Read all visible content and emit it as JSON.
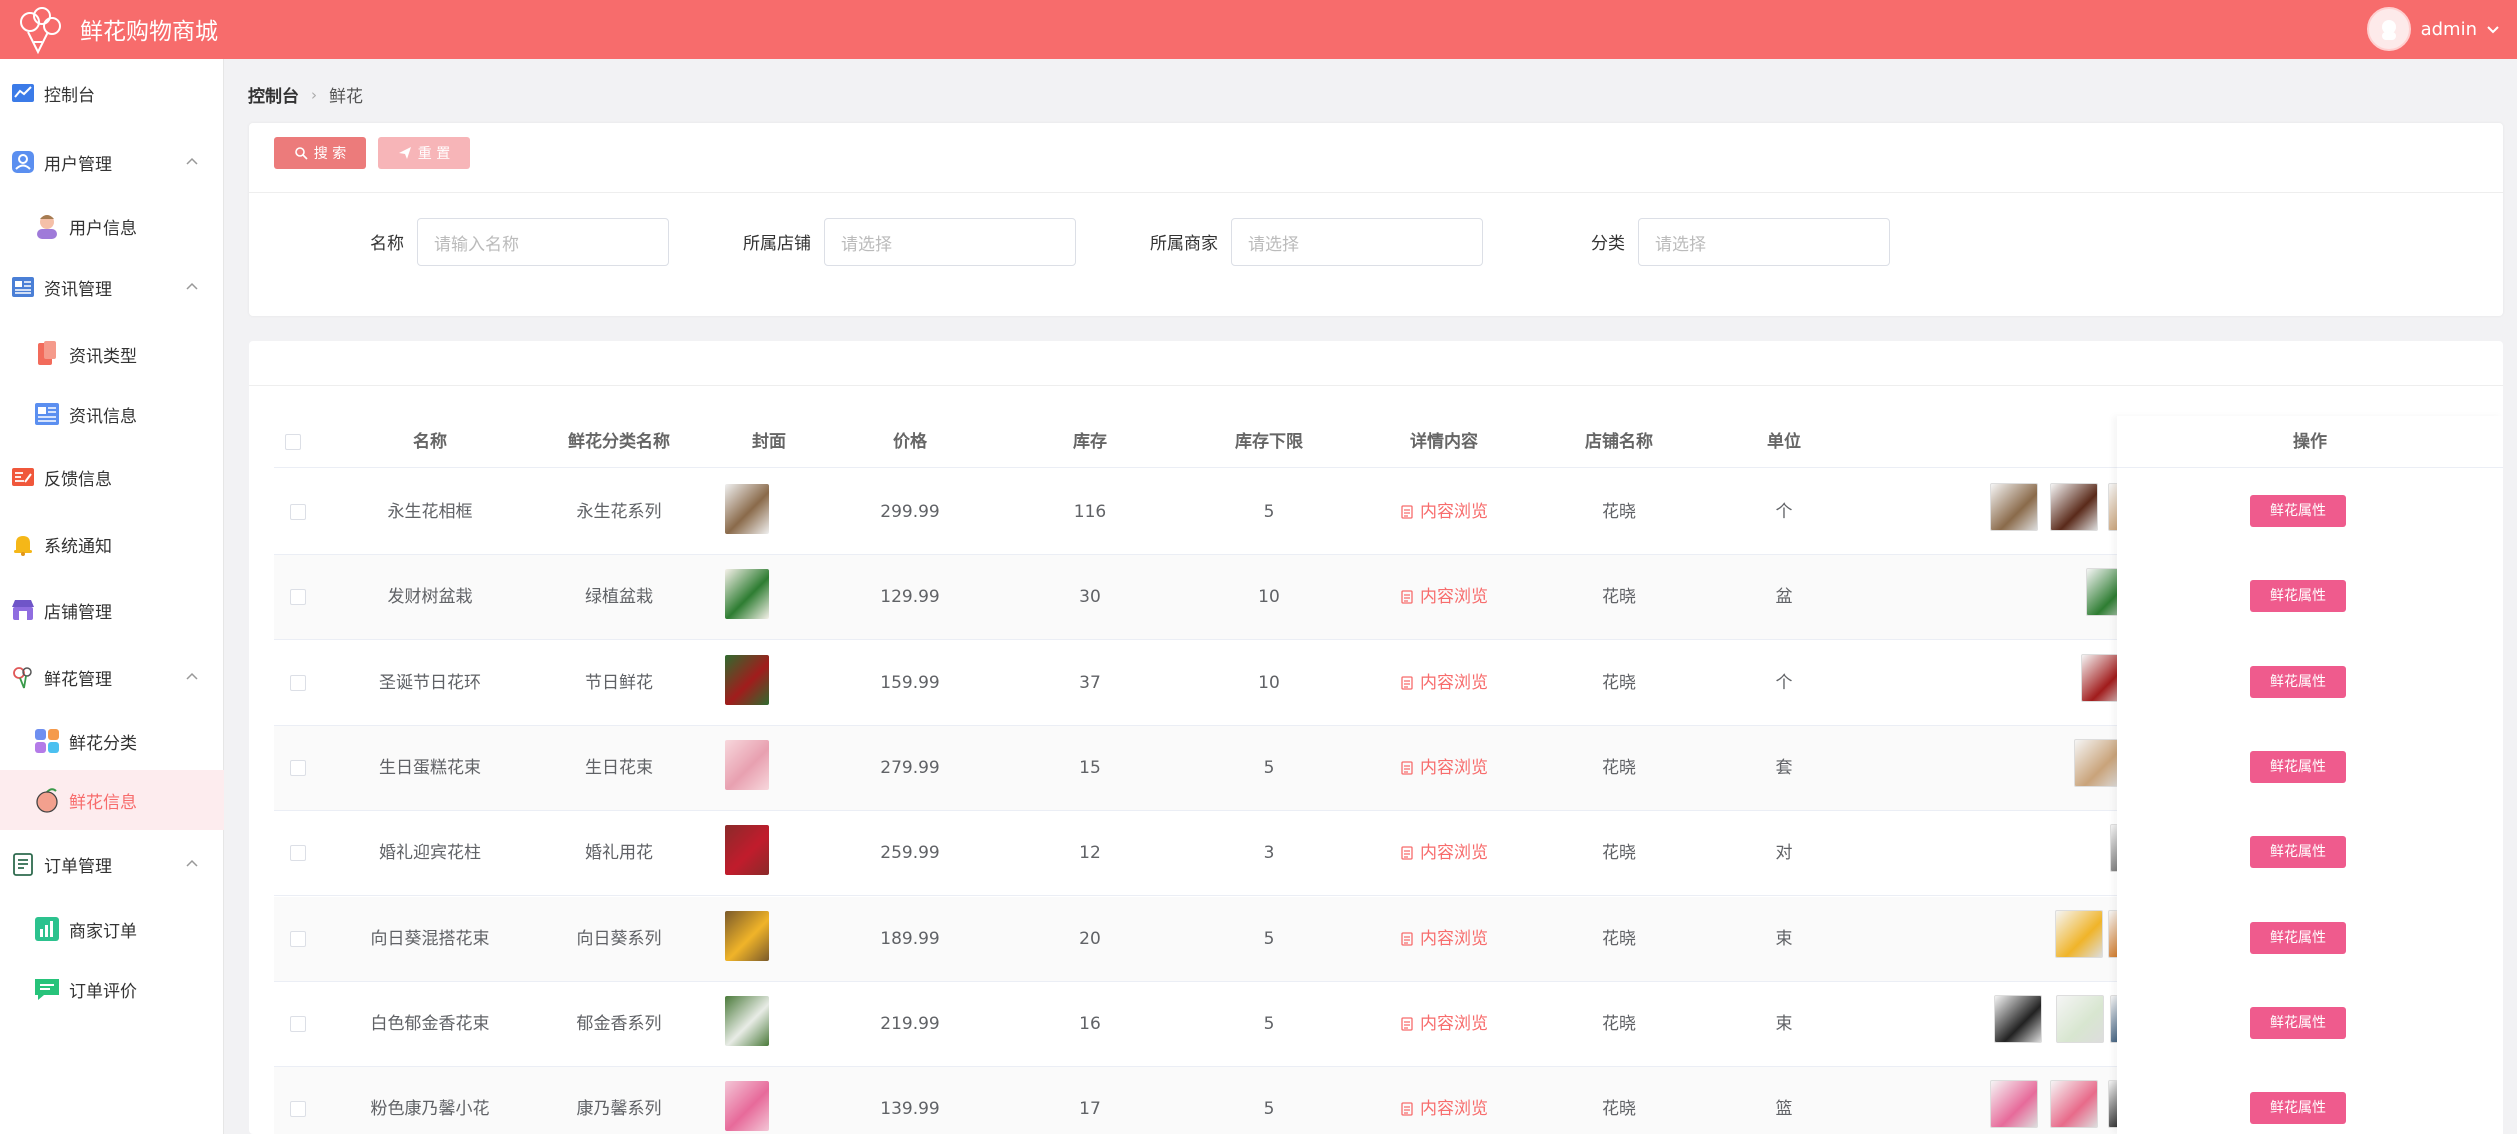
{
  "header": {
    "app_title": "鲜花购物商城",
    "user_name": "admin"
  },
  "sidebar": {
    "items": [
      {
        "label": "控制台",
        "icon": "chart-line-icon"
      },
      {
        "label": "用户管理",
        "icon": "user-icon"
      },
      {
        "label": "用户信息",
        "icon": "user-avatar-icon"
      },
      {
        "label": "资讯管理",
        "icon": "news-icon"
      },
      {
        "label": "资讯类型",
        "icon": "bookmark-icon"
      },
      {
        "label": "资讯信息",
        "icon": "newspaper-icon"
      },
      {
        "label": "反馈信息",
        "icon": "feedback-icon"
      },
      {
        "label": "系统通知",
        "icon": "bell-icon"
      },
      {
        "label": "店铺管理",
        "icon": "shop-icon"
      },
      {
        "label": "鲜花管理",
        "icon": "flower-icon"
      },
      {
        "label": "鲜花分类",
        "icon": "grid-icon"
      },
      {
        "label": "鲜花信息",
        "icon": "peach-icon"
      },
      {
        "label": "订单管理",
        "icon": "order-icon"
      },
      {
        "label": "商家订单",
        "icon": "bar-chart-icon"
      },
      {
        "label": "订单评价",
        "icon": "comment-icon"
      }
    ]
  },
  "breadcrumb": {
    "home": "控制台",
    "current": "鲜花"
  },
  "search": {
    "search_btn": "搜 索",
    "reset_btn": "重 置",
    "fields": [
      {
        "label": "名称",
        "placeholder": "请输入名称"
      },
      {
        "label": "所属店铺",
        "placeholder": "请选择"
      },
      {
        "label": "所属商家",
        "placeholder": "请选择"
      },
      {
        "label": "分类",
        "placeholder": "请选择"
      }
    ]
  },
  "table": {
    "headers": [
      "名称",
      "鲜花分类名称",
      "封面",
      "价格",
      "库存",
      "库存下限",
      "详情内容",
      "店铺名称",
      "单位",
      "操作"
    ],
    "detail_label": "内容浏览",
    "op_label": "鲜花属性",
    "rows": [
      {
        "name": "永生花相框",
        "category": "永生花系列",
        "price": "299.99",
        "stock": "116",
        "min": "5",
        "shop": "花晓",
        "unit": "个"
      },
      {
        "name": "发财树盆栽",
        "category": "绿植盆栽",
        "price": "129.99",
        "stock": "30",
        "min": "10",
        "shop": "花晓",
        "unit": "盆"
      },
      {
        "name": "圣诞节日花环",
        "category": "节日鲜花",
        "price": "159.99",
        "stock": "37",
        "min": "10",
        "shop": "花晓",
        "unit": "个"
      },
      {
        "name": "生日蛋糕花束",
        "category": "生日花束",
        "price": "279.99",
        "stock": "15",
        "min": "5",
        "shop": "花晓",
        "unit": "套"
      },
      {
        "name": "婚礼迎宾花柱",
        "category": "婚礼用花",
        "price": "259.99",
        "stock": "12",
        "min": "3",
        "shop": "花晓",
        "unit": "对"
      },
      {
        "name": "向日葵混搭花束",
        "category": "向日葵系列",
        "price": "189.99",
        "stock": "20",
        "min": "5",
        "shop": "花晓",
        "unit": "束"
      },
      {
        "name": "白色郁金香花束",
        "category": "郁金香系列",
        "price": "219.99",
        "stock": "16",
        "min": "5",
        "shop": "花晓",
        "unit": "束"
      },
      {
        "name": "粉色康乃馨小花篮",
        "category": "康乃馨系列",
        "price": "139.99",
        "stock": "17",
        "min": "5",
        "shop": "花晓",
        "unit": "篮"
      }
    ]
  },
  "colors": {
    "brand": "#f76c6c",
    "op_button": "#ef5b8d",
    "reset_button": "#f7b5b8"
  }
}
